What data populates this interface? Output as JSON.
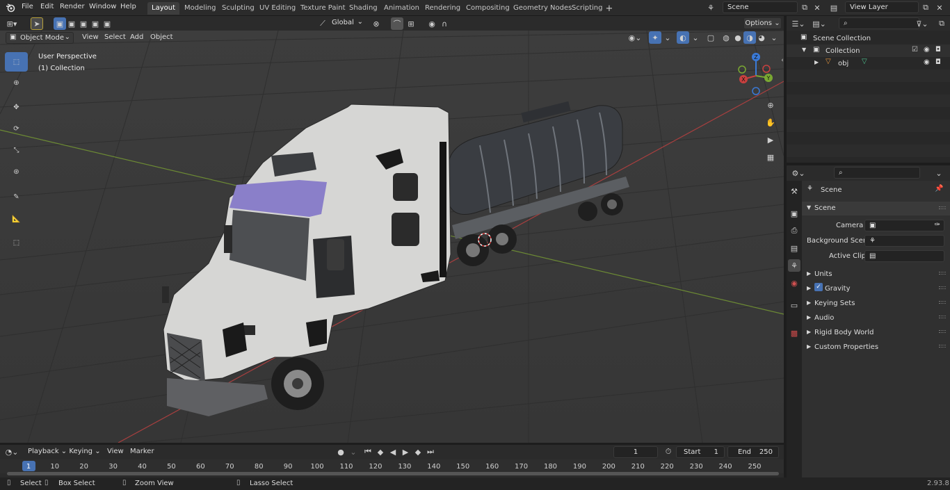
{
  "topbar": {
    "menus": [
      "File",
      "Edit",
      "Render",
      "Window",
      "Help"
    ],
    "workspaces": [
      "Layout",
      "Modeling",
      "Sculpting",
      "UV Editing",
      "Texture Paint",
      "Shading",
      "Animation",
      "Rendering",
      "Compositing",
      "Geometry Nodes",
      "Scripting"
    ],
    "active_workspace": "Layout",
    "scene_name": "Scene",
    "view_layer": "View Layer"
  },
  "viewport_header": {
    "mode": "Object Mode",
    "menus": [
      "View",
      "Select",
      "Add",
      "Object"
    ],
    "orientation": "Global",
    "options_label": "Options"
  },
  "viewport": {
    "perspective": "User Perspective",
    "collection": "(1) Collection",
    "gizmo_axes": {
      "z": "Z",
      "y": "Y",
      "x": "X"
    }
  },
  "outliner": {
    "root": "Scene Collection",
    "collection": "Collection",
    "object": "obj"
  },
  "properties": {
    "context": "Scene",
    "section": "Scene",
    "fields": [
      {
        "label": "Camera",
        "value": ""
      },
      {
        "label": "Background Scene",
        "value": ""
      },
      {
        "label": "Active Clip",
        "value": ""
      }
    ],
    "panels": [
      "Units",
      "Gravity",
      "Keying Sets",
      "Audio",
      "Rigid Body World",
      "Custom Properties"
    ]
  },
  "timeline": {
    "menus": [
      "Playback",
      "Keying",
      "View",
      "Marker"
    ],
    "current_frame": "1",
    "start_label": "Start",
    "start_value": "1",
    "end_label": "End",
    "end_value": "250",
    "ticks": [
      "1",
      "10",
      "20",
      "30",
      "40",
      "50",
      "60",
      "70",
      "80",
      "90",
      "100",
      "110",
      "120",
      "130",
      "140",
      "150",
      "160",
      "170",
      "180",
      "190",
      "200",
      "210",
      "220",
      "230",
      "240",
      "250"
    ]
  },
  "statusbar": {
    "select": "Select",
    "box_select": "Box Select",
    "zoom_view": "Zoom View",
    "lasso_select": "Lasso Select",
    "version": "2.93.8"
  },
  "colors": {
    "accent": "#4772b3",
    "axis_x": "#c9403f",
    "axis_y": "#7aa832",
    "axis_z": "#3a7ad8",
    "frame_marker": "#4772b3"
  }
}
